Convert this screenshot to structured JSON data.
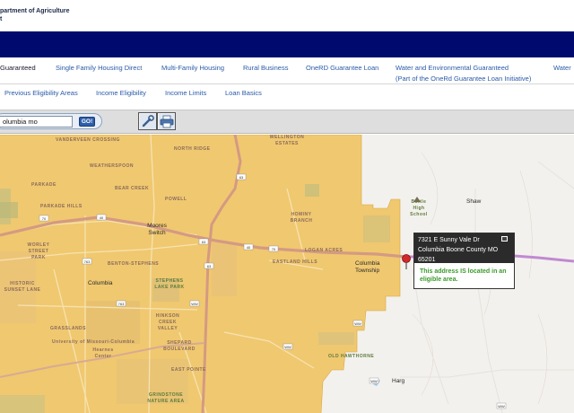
{
  "header": {
    "agency_line1": "partment of Agriculture",
    "agency_line2": "t",
    "banner_color": "#000a6e"
  },
  "nav_primary": [
    {
      "label": "Guaranteed",
      "sub": ""
    },
    {
      "label": "Single Family Housing Direct",
      "sub": ""
    },
    {
      "label": "Multi-Family Housing",
      "sub": ""
    },
    {
      "label": "Rural Business",
      "sub": ""
    },
    {
      "label": "OneRD Guarantee Loan",
      "sub": ""
    },
    {
      "label": "Water and Environmental Guaranteed",
      "sub": "(Part of the OneRd Guarantee Loan Initiative)"
    },
    {
      "label": "Water",
      "sub": ""
    }
  ],
  "nav_secondary": [
    {
      "label": "Previous Eligibility Areas"
    },
    {
      "label": "Income Eligibility"
    },
    {
      "label": "Income Limits"
    },
    {
      "label": "Loan Basics"
    }
  ],
  "toolbar": {
    "search_value": "olumbia mo",
    "go_label": "GO!",
    "tools": [
      "wrench-icon",
      "printer-icon"
    ]
  },
  "map": {
    "eligible_color": "#f0c870",
    "ineligible_color": "#ffffff",
    "route_color": "#c08ad0",
    "labels": [
      {
        "text": "VANDERVEEN CROSSING",
        "kind": "area"
      },
      {
        "text": "NORTH RIDGE",
        "kind": "area"
      },
      {
        "text": "WELLINGTON ESTATES",
        "kind": "area"
      },
      {
        "text": "WEATHERSPOON",
        "kind": "area"
      },
      {
        "text": "PARKADE",
        "kind": "area"
      },
      {
        "text": "BEAR CREEK",
        "kind": "area"
      },
      {
        "text": "POWELL",
        "kind": "area"
      },
      {
        "text": "PARKADE HILLS",
        "kind": "area"
      },
      {
        "text": "HOMINY BRANCH",
        "kind": "area"
      },
      {
        "text": "Battle High School",
        "kind": "poi"
      },
      {
        "text": "Shaw",
        "kind": "town"
      },
      {
        "text": "Moores Switch",
        "kind": "town"
      },
      {
        "text": "WORLEY STREET PARK",
        "kind": "area"
      },
      {
        "text": "LOGAN ACRES",
        "kind": "area"
      },
      {
        "text": "BENTON-STEPHENS",
        "kind": "area"
      },
      {
        "text": "EASTLAND HILLS",
        "kind": "area"
      },
      {
        "text": "Columbia Township",
        "kind": "town"
      },
      {
        "text": "HISTORIC SUNSET LANE",
        "kind": "area"
      },
      {
        "text": "Columbia",
        "kind": "town"
      },
      {
        "text": "STEPHENS LAKE PARK",
        "kind": "area"
      },
      {
        "text": "HINKSON CREEK VALLEY",
        "kind": "area"
      },
      {
        "text": "GRASSLANDS",
        "kind": "area"
      },
      {
        "text": "University of Missouri-Columbia",
        "kind": "area"
      },
      {
        "text": "SHEPARD BOULEVARD",
        "kind": "area"
      },
      {
        "text": "Hearnes Center",
        "kind": "area"
      },
      {
        "text": "EAST POINTE",
        "kind": "area"
      },
      {
        "text": "OLD HAWTHORNE",
        "kind": "area"
      },
      {
        "text": "GRINDSTONE NATURE AREA",
        "kind": "area"
      },
      {
        "text": "Harg",
        "kind": "town"
      }
    ]
  },
  "popup": {
    "address_line1": "7321 E Sunny Vale Dr",
    "address_line2": "Columbia Boone County MO",
    "address_line3": "65201",
    "message": "This address IS located in an eligible area.",
    "message_color": "#3a9a2a"
  }
}
